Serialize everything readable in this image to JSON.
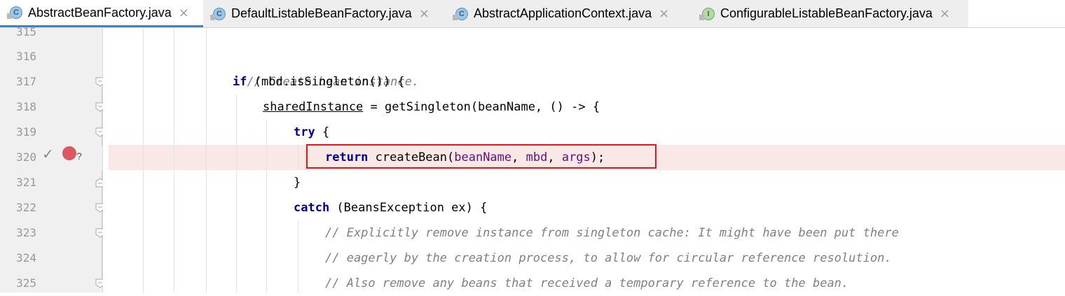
{
  "tabs": [
    {
      "label": "AbstractBeanFactory.java",
      "icon": "class-c-icon",
      "icon_letter": "C",
      "active": true
    },
    {
      "label": "DefaultListableBeanFactory.java",
      "icon": "class-c-icon",
      "icon_letter": "C",
      "active": false
    },
    {
      "label": "AbstractApplicationContext.java",
      "icon": "class-c-icon",
      "icon_letter": "C",
      "active": false
    },
    {
      "label": "ConfigurableListableBeanFactory.java",
      "icon": "interface-i-icon",
      "icon_letter": "I",
      "active": false
    }
  ],
  "close_glyph": "×",
  "line_numbers": [
    "315",
    "316",
    "317",
    "318",
    "319",
    "320",
    "321",
    "322",
    "323",
    "324",
    "325"
  ],
  "gutter": {
    "check_glyph": "✓",
    "breakpoint_question": "?"
  },
  "code": {
    "l316": "// Create bean instance.",
    "l317_kw": "if",
    "l317_rest": " (mbd.isSingleton()) {",
    "l318_var": "sharedInstance",
    "l318_rest": " = getSingleton(beanName, () -> {",
    "l319_kw": "try",
    "l319_rest": " {",
    "l320_kw": "return",
    "l320_call": " createBean(",
    "l320_p1": "beanName",
    "l320_sep1": ", ",
    "l320_p2": "mbd",
    "l320_sep2": ", ",
    "l320_p3": "args",
    "l320_end": ");",
    "l321": "}",
    "l322_kw": "catch",
    "l322_rest": " (BeansException ex) {",
    "l323": "// Explicitly remove instance from singleton cache: It might have been put there",
    "l324": "// eagerly by the creation process, to allow for circular reference resolution.",
    "l325": "// Also remove any beans that received a temporary reference to the bean."
  },
  "colors": {
    "accent": "#4083c9",
    "keyword": "#000080",
    "comment": "#808080",
    "param": "#660e7a",
    "breakpoint": "#db5860",
    "highlight": "#fae8e6",
    "annotation_box": "#e5151b"
  }
}
